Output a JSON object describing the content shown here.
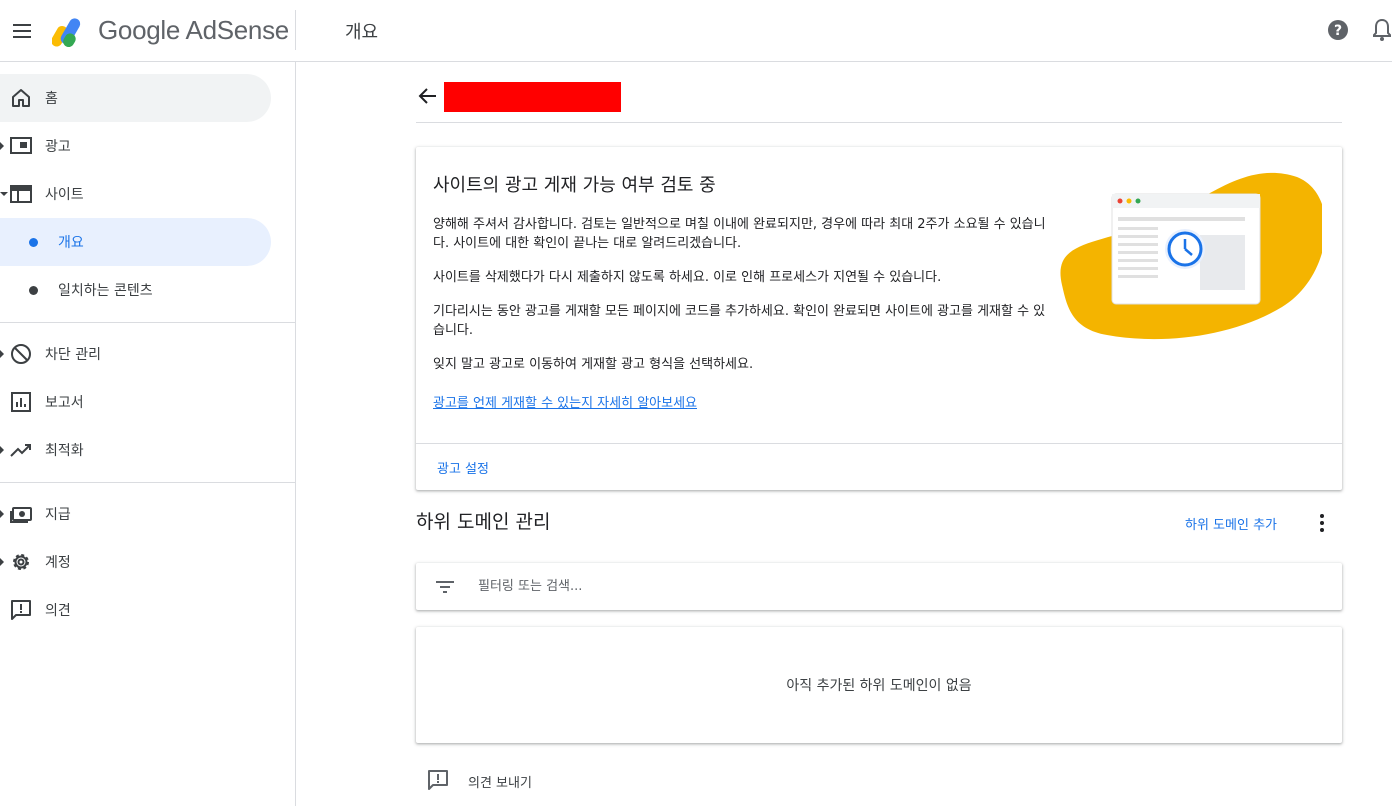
{
  "header": {
    "brand": "Google AdSense",
    "page_title": "개요"
  },
  "sidebar": {
    "items": [
      {
        "label": "홈",
        "icon": "home-icon"
      },
      {
        "label": "광고",
        "icon": "ads-icon"
      },
      {
        "label": "사이트",
        "icon": "sites-icon"
      },
      {
        "label": "개요"
      },
      {
        "label": "일치하는 콘텐츠"
      },
      {
        "label": "차단 관리",
        "icon": "block-icon"
      },
      {
        "label": "보고서",
        "icon": "reports-icon"
      },
      {
        "label": "최적화",
        "icon": "trending-icon"
      },
      {
        "label": "지급",
        "icon": "payments-icon"
      },
      {
        "label": "계정",
        "icon": "gear-icon"
      },
      {
        "label": "의견",
        "icon": "feedback-icon"
      }
    ]
  },
  "review": {
    "title": "사이트의 광고 게재 가능 여부 검토 중",
    "paragraphs": [
      "양해해 주셔서 감사합니다. 검토는 일반적으로 며칠 이내에 완료되지만, 경우에 따라 최대 2주가 소요될 수 있습니다. 사이트에 대한 확인이 끝나는 대로 알려드리겠습니다.",
      "사이트를 삭제했다가 다시 제출하지 않도록 하세요. 이로 인해 프로세스가 지연될 수 있습니다.",
      "기다리시는 동안 광고를 게재할 모든 페이지에 코드를 추가하세요. 확인이 완료되면 사이트에 광고를 게재할 수 있습니다.",
      "잊지 말고 광고로 이동하여 게재할 광고 형식을 선택하세요."
    ],
    "link": "광고를 언제 게재할 수 있는지 자세히 알아보세요",
    "footer_action": "광고 설정"
  },
  "subdomains": {
    "title": "하위 도메인 관리",
    "add_label": "하위 도메인 추가",
    "filter_placeholder": "필터링 또는 검색...",
    "empty_text": "아직 추가된 하위 도메인이 없음"
  },
  "feedback": {
    "label": "의견 보내기"
  },
  "colors": {
    "accent": "#1a73e8",
    "illustration_yellow": "#f4b400",
    "redacted": "#ff0000"
  }
}
